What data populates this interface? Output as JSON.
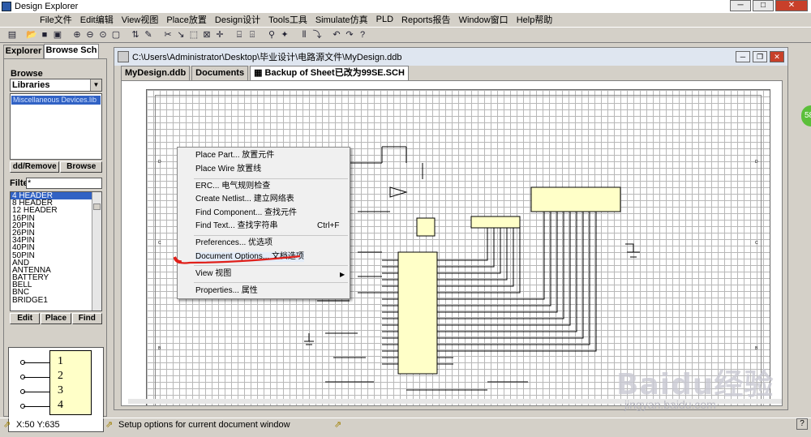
{
  "window": {
    "title": "Design Explorer"
  },
  "menubar": {
    "items": [
      "File文件",
      "Edit编辑",
      "View视图",
      "Place放置",
      "Design设计",
      "Tools工具",
      "Simulate仿真",
      "PLD",
      "Reports报告",
      "Window窗口",
      "Help帮助"
    ]
  },
  "panel": {
    "tabs": [
      "Explorer",
      "Browse Sch"
    ],
    "browse_label": "Browse",
    "browse_select": "Libraries",
    "libraries": [
      "Miscellaneous Devices.lib"
    ],
    "add_remove": "dd/Remove",
    "browse_btn": "Browse",
    "filter_label": "Filte",
    "filter_value": "*",
    "components": [
      "4 HEADER",
      "8 HEADER",
      "12 HEADER",
      "16PIN",
      "20PIN",
      "26PIN",
      "34PIN",
      "40PIN",
      "50PIN",
      "AND",
      "ANTENNA",
      "BATTERY",
      "BELL",
      "BNC",
      "BRIDGE1"
    ],
    "edit_btn": "Edit",
    "place_btn": "Place",
    "find_btn": "Find",
    "preview_pins": [
      "1",
      "2",
      "3",
      "4"
    ]
  },
  "document": {
    "path": "C:\\Users\\Administrator\\Desktop\\毕业设计\\电路源文件\\MyDesign.ddb",
    "tabs": [
      "MyDesign.ddb",
      "Documents",
      "Backup of Sheet已改为99SE.SCH"
    ]
  },
  "context_menu": {
    "place_part": "Place Part... 放置元件",
    "place_wire": "Place Wire 放置线",
    "erc": "ERC... 电气规则检查",
    "netlist": "Create Netlist... 建立网络表",
    "find_component": "Find Component... 查找元件",
    "find_text": "Find Text... 查找字符串",
    "find_text_shortcut": "Ctrl+F",
    "preferences": "Preferences... 优选项",
    "document_options": "Document Options... 文档选项",
    "view": "View 视图",
    "properties": "Properties... 属性"
  },
  "status": {
    "coords": "X:50 Y:635",
    "message": "Setup options for current document window"
  },
  "badge": "58",
  "watermark": {
    "line1": "Baidu经验",
    "line2": "jingyan.baidu.com"
  }
}
